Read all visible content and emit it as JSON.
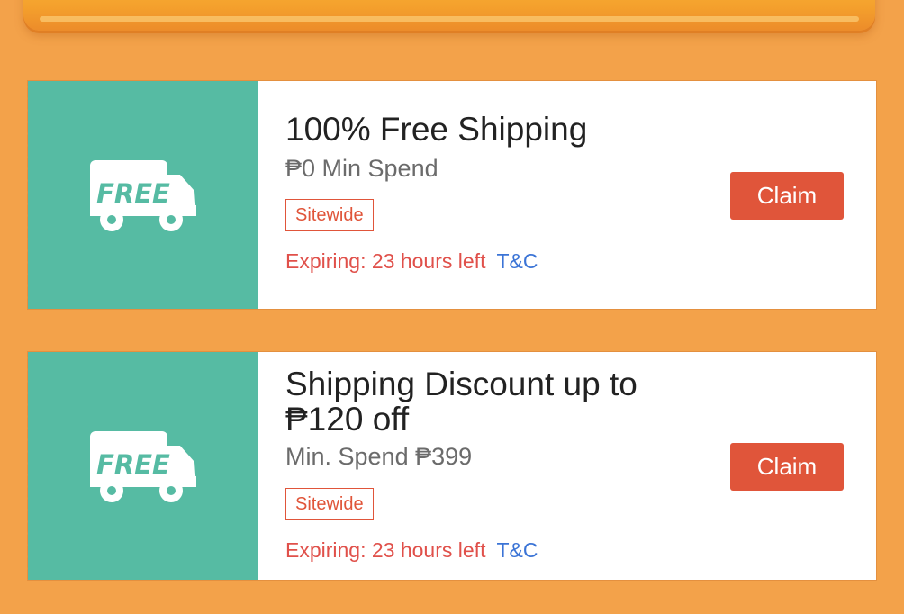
{
  "colors": {
    "background": "#f3a24a",
    "voucher_accent": "#56bba3",
    "button": "#e0553a",
    "expiry_text": "#e0504a",
    "link": "#3b74d6"
  },
  "vouchers": [
    {
      "icon": "free-shipping-truck-icon",
      "icon_text": "FREE",
      "title": "100% Free Shipping",
      "min_spend": "₱0 Min Spend",
      "tag": "Sitewide",
      "expiry": "Expiring: 23 hours left",
      "terms_link": "T&C",
      "claim_label": "Claim"
    },
    {
      "icon": "free-shipping-truck-icon",
      "icon_text": "FREE",
      "title": "Shipping Discount up to ₱120 off",
      "min_spend": "Min. Spend ₱399",
      "tag": "Sitewide",
      "expiry": "Expiring: 23 hours left",
      "terms_link": "T&C",
      "claim_label": "Claim"
    }
  ]
}
